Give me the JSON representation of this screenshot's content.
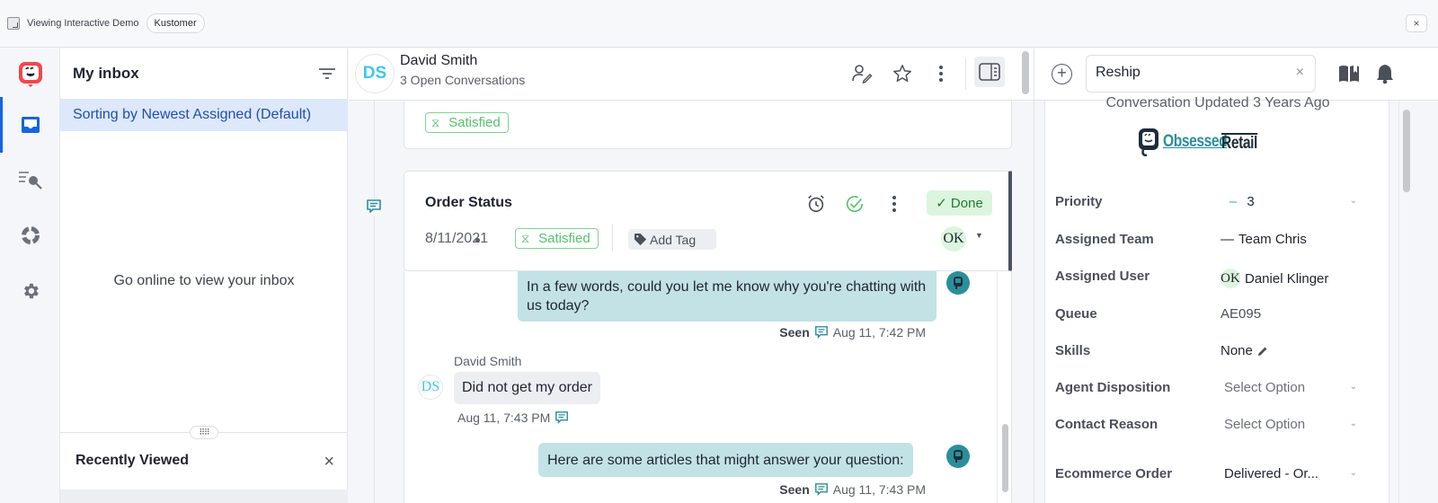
{
  "topbar": {
    "demo_label": "Viewing Interactive Demo",
    "brand_pill": "Kustomer",
    "close_label": "×"
  },
  "colors": {
    "accent_blue": "#1565e0",
    "satisfied_green": "#55c36a",
    "done_bg": "#dcf5de",
    "agent_bubble": "#c2e2e6",
    "brand_teal": "#2a8f9a",
    "logo_red": "#f0484c"
  },
  "rail": {
    "items": [
      {
        "name": "inbox",
        "icon": "inbox-icon",
        "active": true
      },
      {
        "name": "search",
        "icon": "search-list-icon",
        "active": false
      },
      {
        "name": "reports",
        "icon": "donut-chart-icon",
        "active": false
      },
      {
        "name": "settings",
        "icon": "gear-icon",
        "active": false
      }
    ]
  },
  "inbox": {
    "title": "My inbox",
    "sort_label": "Sorting by Newest Assigned (Default)",
    "empty_message": "Go online to view your inbox",
    "drag_handle": "⠿⠿",
    "recently_viewed_title": "Recently Viewed",
    "recently_viewed_close": "×"
  },
  "conversation": {
    "customer": {
      "initials": "DS",
      "name": "David Smith",
      "subtitle": "3 Open Conversations"
    },
    "previous_card": {
      "satisfaction": "Satisfied"
    },
    "order_card": {
      "title": "Order Status",
      "date": "8/11/2021",
      "satisfaction": "Satisfied",
      "add_tag_label": "Add Tag",
      "done_label": "✓ Done",
      "assignee_initials": "OK"
    },
    "messages": [
      {
        "from": "agent",
        "text": "In a few words, could you let me know why you're chatting with us today?",
        "status": "Seen",
        "time": "Aug 11, 7:42 PM"
      },
      {
        "from": "customer",
        "sender": "David Smith",
        "initials": "DS",
        "text": "Did not get my order",
        "time": "Aug 11, 7:43 PM"
      },
      {
        "from": "agent",
        "text": "Here are some articles that might answer your question:",
        "status": "Seen",
        "time": "Aug 11, 7:43 PM"
      }
    ]
  },
  "right_panel": {
    "search_value": "Reship",
    "clear_label": "×",
    "plus_label": "+",
    "conversation_updated": "Conversation Updated 3 Years Ago",
    "logo": {
      "part1": "Obsessed",
      "part2": "Retail"
    },
    "fields": [
      {
        "label": "Priority",
        "value": "3",
        "prefix": "–",
        "dropdown": true
      },
      {
        "label": "Assigned Team",
        "value": "Team Chris",
        "prefix": "—",
        "dropdown": false
      },
      {
        "label": "Assigned User",
        "value": "Daniel Klinger",
        "avatar": "OK",
        "dropdown": false
      },
      {
        "label": "Queue",
        "value": "AE095",
        "dropdown": false
      },
      {
        "label": "Skills",
        "value": "None",
        "editable": true,
        "dropdown": false
      },
      {
        "label": "Agent Disposition",
        "value": "Select Option",
        "placeholder": true,
        "dropdown": true
      },
      {
        "label": "Contact Reason",
        "value": "Select Option",
        "placeholder": true,
        "dropdown": true
      },
      {
        "label": "Ecommerce Order",
        "value": "Delivered - Or...",
        "dropdown": true
      }
    ]
  }
}
